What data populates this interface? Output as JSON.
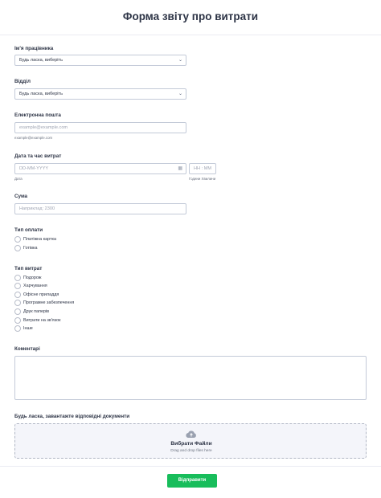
{
  "form": {
    "title": "Форма звіту про витрати"
  },
  "employee": {
    "label": "Ім'я працівника",
    "value": "Будь ласка, виберіть"
  },
  "department": {
    "label": "Відділ",
    "value": "Будь ласка, виберіть"
  },
  "email": {
    "label": "Електронна пошта",
    "placeholder": "example@example.com",
    "sublabel": "example@example.com"
  },
  "datetime": {
    "label": "Дата та час витрат",
    "date_placeholder": "DD-MM-YYYY",
    "time_placeholder": "HH : MM",
    "date_sublabel": "Дата",
    "time_sublabel": "Години Хвилини"
  },
  "amount": {
    "label": "Сума",
    "placeholder": "Наприклад: 2300"
  },
  "payment": {
    "label": "Тип оплати",
    "options": [
      "Платіжна картка",
      "Готівка"
    ]
  },
  "expense_type": {
    "label": "Тип витрат",
    "options": [
      "Подорож",
      "Харчування",
      "Офісне приладдя",
      "Програмне забезпечення",
      "Друк паперів",
      "Витрати на зв'язок",
      "Інше"
    ]
  },
  "comments": {
    "label": "Коментарі"
  },
  "upload": {
    "label": "Будь ласка, завантажте відповідні документи",
    "title": "Вибрати Файли",
    "subtitle": "Drag and drop files here",
    "icon": "upload-cloud-icon"
  },
  "submit": {
    "label": "Відправити",
    "color": "#18bd5b"
  }
}
